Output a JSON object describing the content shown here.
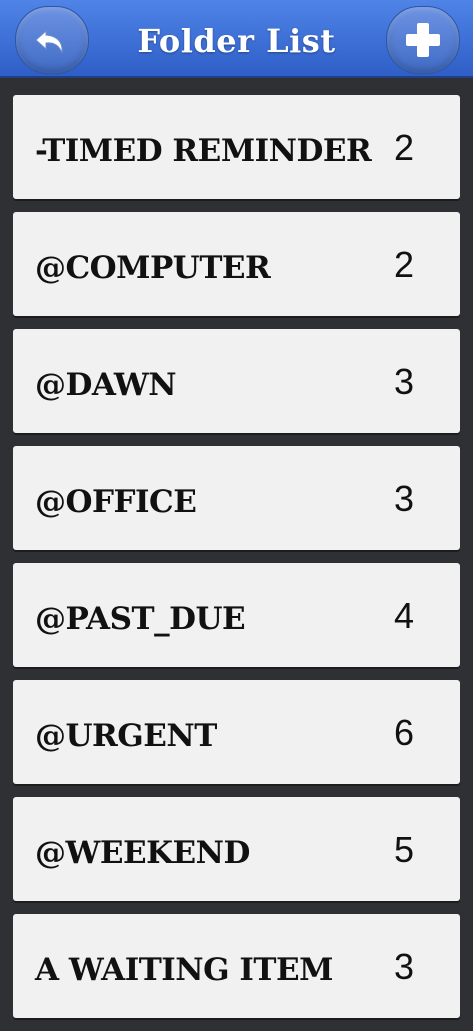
{
  "header": {
    "title": "Folder List",
    "back_icon": "undo-arrow-icon",
    "add_icon": "plus-icon"
  },
  "colors": {
    "header_blue": "#3d6fd6",
    "background": "#2f3033",
    "row_background": "#f1f1f1",
    "text": "#111111"
  },
  "folders": [
    {
      "name": "-TIMED REMINDER",
      "count": "2"
    },
    {
      "name": "@COMPUTER",
      "count": "2"
    },
    {
      "name": "@DAWN",
      "count": "3"
    },
    {
      "name": "@OFFICE",
      "count": "3"
    },
    {
      "name": "@PAST_DUE",
      "count": "4"
    },
    {
      "name": "@URGENT",
      "count": "6"
    },
    {
      "name": "@WEEKEND",
      "count": "5"
    },
    {
      "name": "A WAITING ITEM",
      "count": "3"
    }
  ]
}
